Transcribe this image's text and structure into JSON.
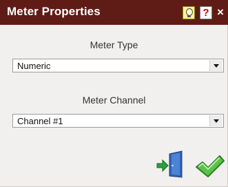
{
  "dialog": {
    "title": "Meter Properties",
    "title_bar_color": "#5f1c17",
    "help_icon": "lightbulb-help-icon",
    "question_label": "?",
    "close_label": "×"
  },
  "fields": {
    "meter_type": {
      "label": "Meter Type",
      "value": "Numeric"
    },
    "meter_channel": {
      "label": "Meter Channel",
      "value": "Channel #1"
    }
  },
  "actions": {
    "exit_icon": "exit-door-icon",
    "ok_icon": "checkmark-icon"
  }
}
